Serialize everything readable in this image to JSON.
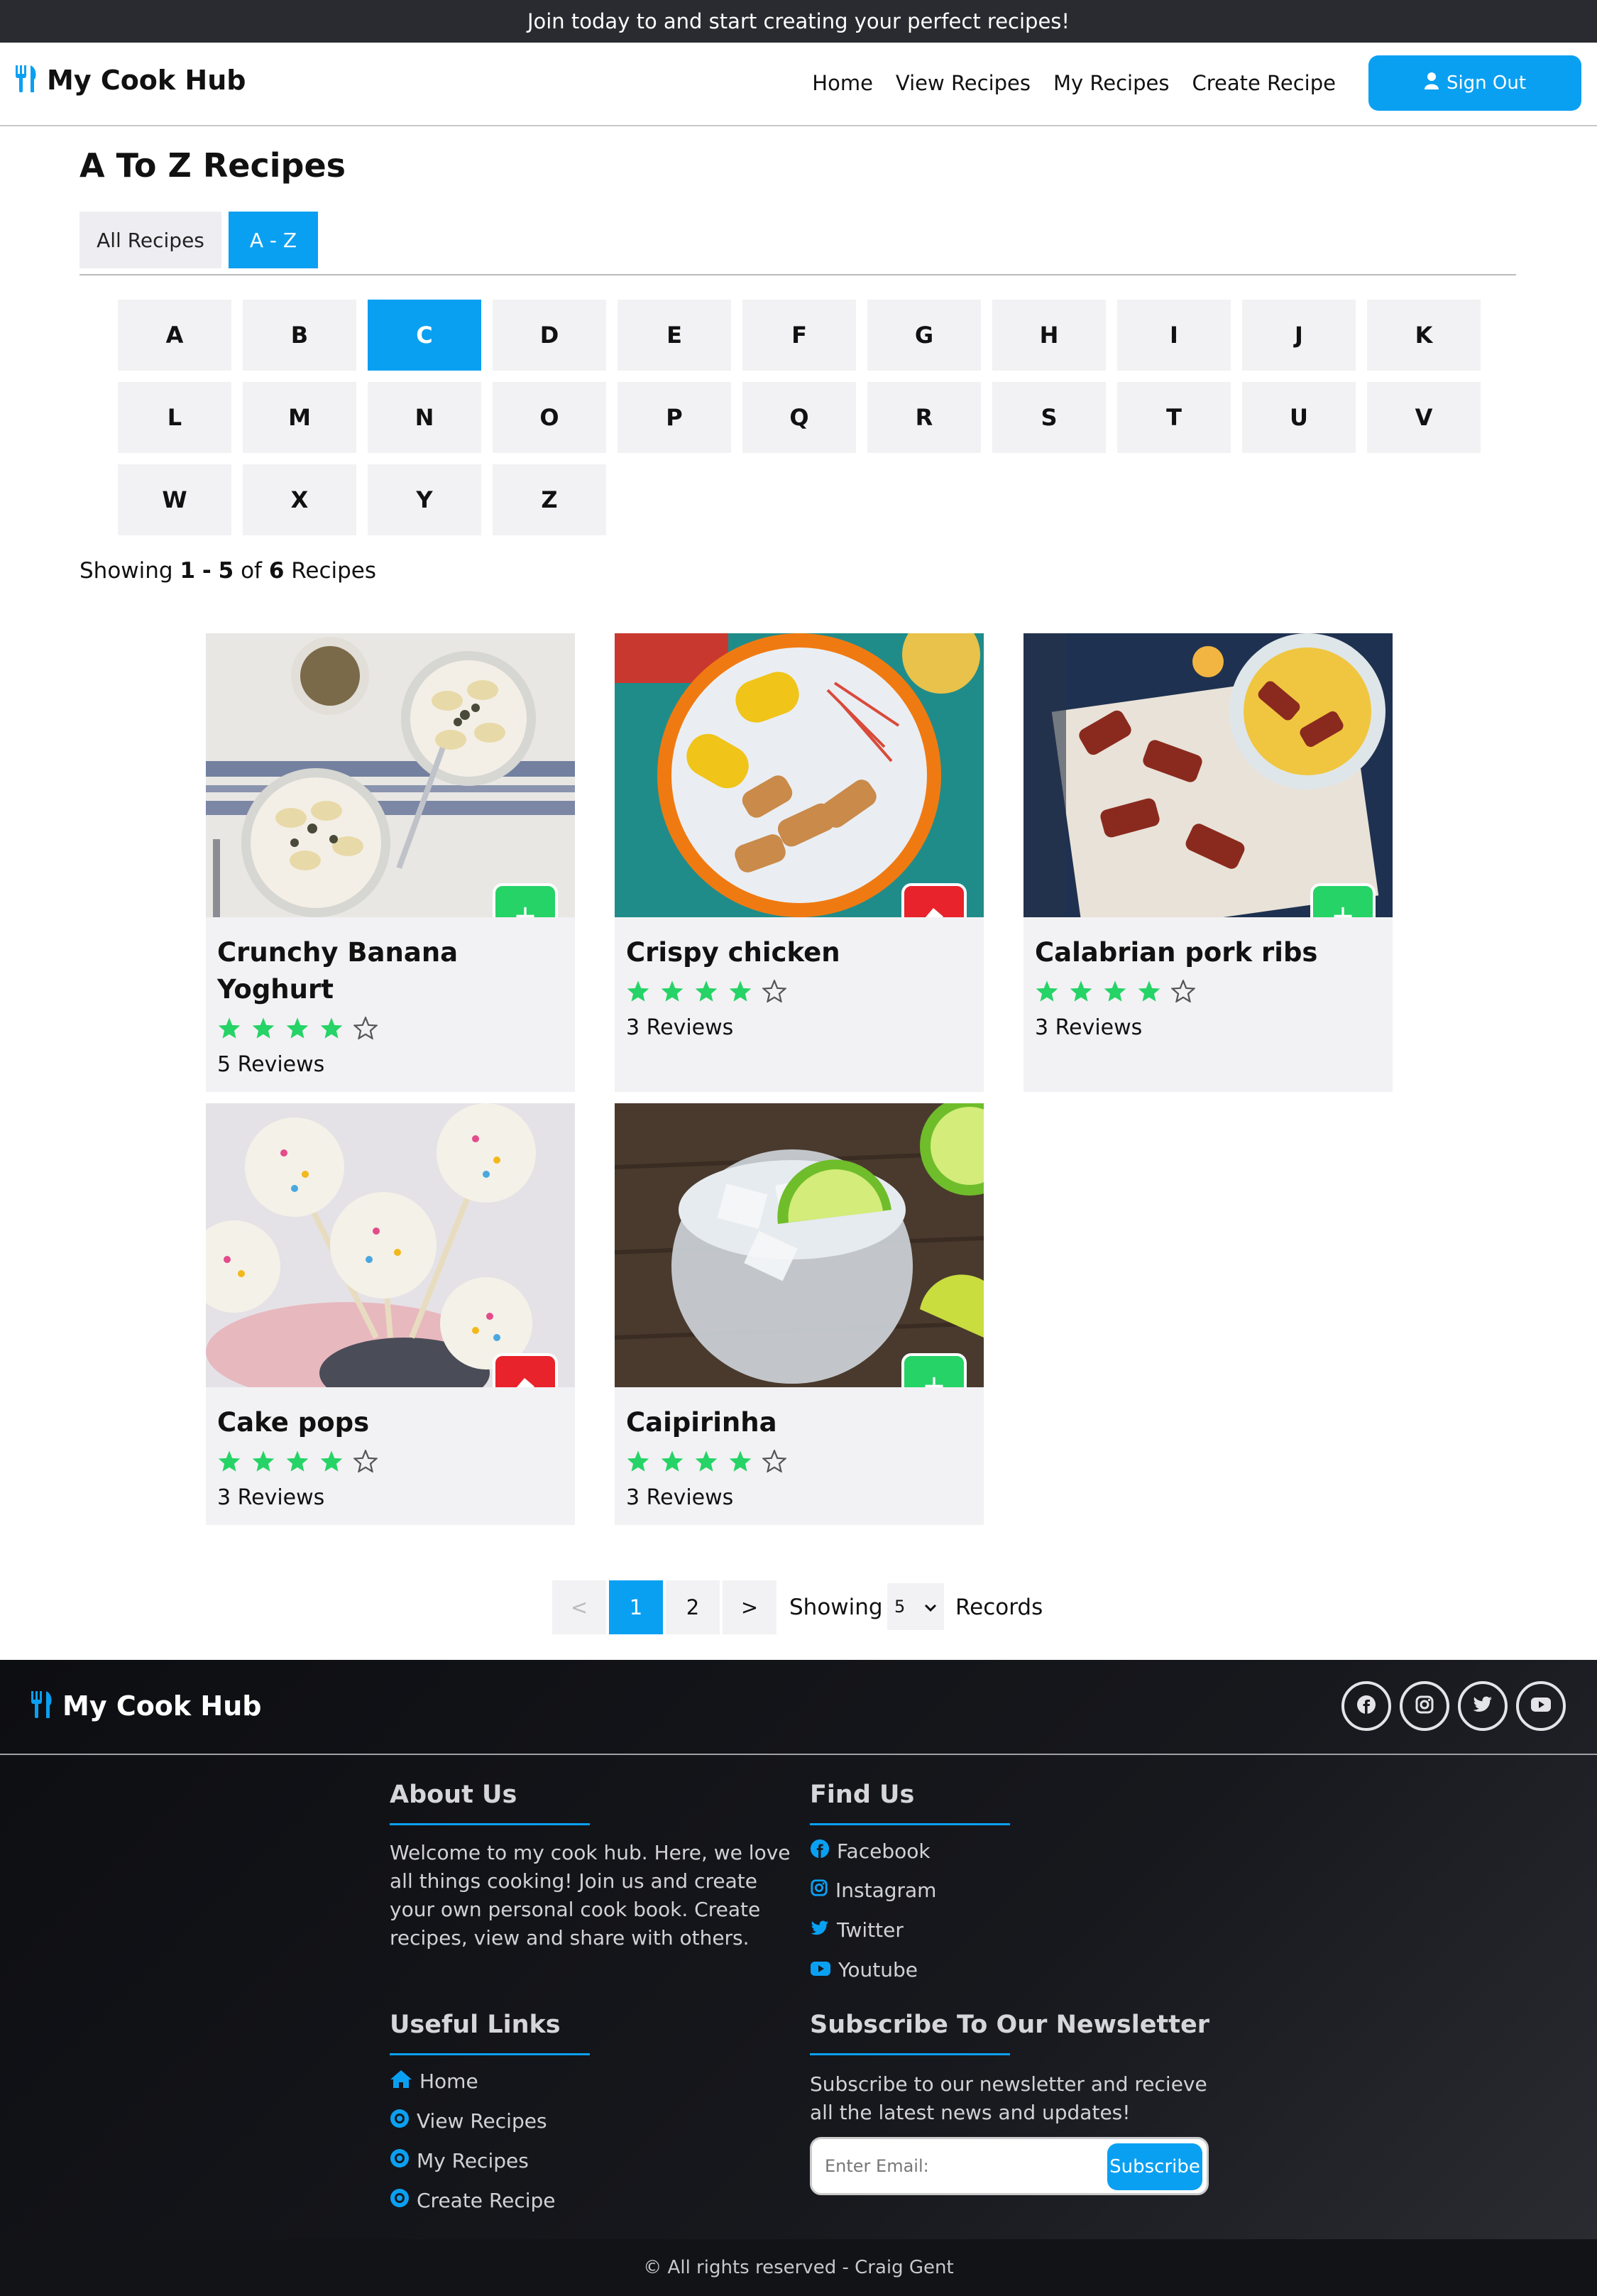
{
  "banner": {
    "text": "Join today to and start creating your perfect recipes!"
  },
  "navbar": {
    "brand": "My Cook Hub",
    "links": [
      "Home",
      "View Recipes",
      "My Recipes",
      "Create Recipe"
    ],
    "signout": "Sign Out"
  },
  "page": {
    "title": "A To Z Recipes",
    "tabs": [
      "All Recipes",
      "A - Z"
    ],
    "active_tab": "A - Z"
  },
  "letters": [
    "A",
    "B",
    "C",
    "D",
    "E",
    "F",
    "G",
    "H",
    "I",
    "J",
    "K",
    "L",
    "M",
    "N",
    "O",
    "P",
    "Q",
    "R",
    "S",
    "T",
    "U",
    "V",
    "W",
    "X",
    "Y",
    "Z"
  ],
  "active_letter": "C",
  "showing": {
    "prefix": "Showing",
    "from": "1",
    "dash": "-",
    "to": "5",
    "of": "of",
    "total": "6",
    "suffix": "Recipes"
  },
  "recipes": [
    {
      "title_line1": "Crunchy Banana",
      "title_line2": "Yoghurt",
      "rating": 4,
      "max_rating": 5,
      "reviews": "5 Reviews",
      "action": "add"
    },
    {
      "title_line1": "Crispy chicken",
      "title_line2": "",
      "rating": 4,
      "max_rating": 5,
      "reviews": "3 Reviews",
      "action": "remove"
    },
    {
      "title_line1": "Calabrian pork ribs",
      "title_line2": "",
      "rating": 4,
      "max_rating": 5,
      "reviews": "3 Reviews",
      "action": "add"
    },
    {
      "title_line1": "Cake pops",
      "title_line2": "",
      "rating": 4,
      "max_rating": 5,
      "reviews": "3 Reviews",
      "action": "remove"
    },
    {
      "title_line1": "Caipirinha",
      "title_line2": "",
      "rating": 4,
      "max_rating": 5,
      "reviews": "3 Reviews",
      "action": "add"
    }
  ],
  "pagination": {
    "prev": "<",
    "pages": [
      "1",
      "2"
    ],
    "current": "1",
    "next": ">",
    "showing_label": "Showing",
    "records_value": "5",
    "records_label": "Records"
  },
  "footer": {
    "brand": "My Cook Hub",
    "about_title": "About Us",
    "about_text": "Welcome to my cook hub. Here, we love all things cooking! Join us and create your own personal cook book. Create recipes, view and share with others.",
    "find_title": "Find Us",
    "find_links": [
      "Facebook",
      "Instagram",
      "Twitter",
      "Youtube"
    ],
    "useful_title": "Useful Links",
    "useful_links": [
      "Home",
      "View Recipes",
      "My Recipes",
      "Create Recipe"
    ],
    "newsletter_title": "Subscribe To Our Newsletter",
    "newsletter_text": "Subscribe to our newsletter and recieve all the latest news and updates!",
    "email_placeholder": "Enter Email:",
    "subscribe_label": "Subscribe",
    "copyright": "© All rights reserved - Craig Gent"
  },
  "colors": {
    "accent": "#0aa0f2",
    "add_green": "#26d366",
    "remove_red": "#e8232b",
    "star_green": "#26d366",
    "banner_bg": "#2a2b31",
    "footer_bg": "#17181d"
  }
}
